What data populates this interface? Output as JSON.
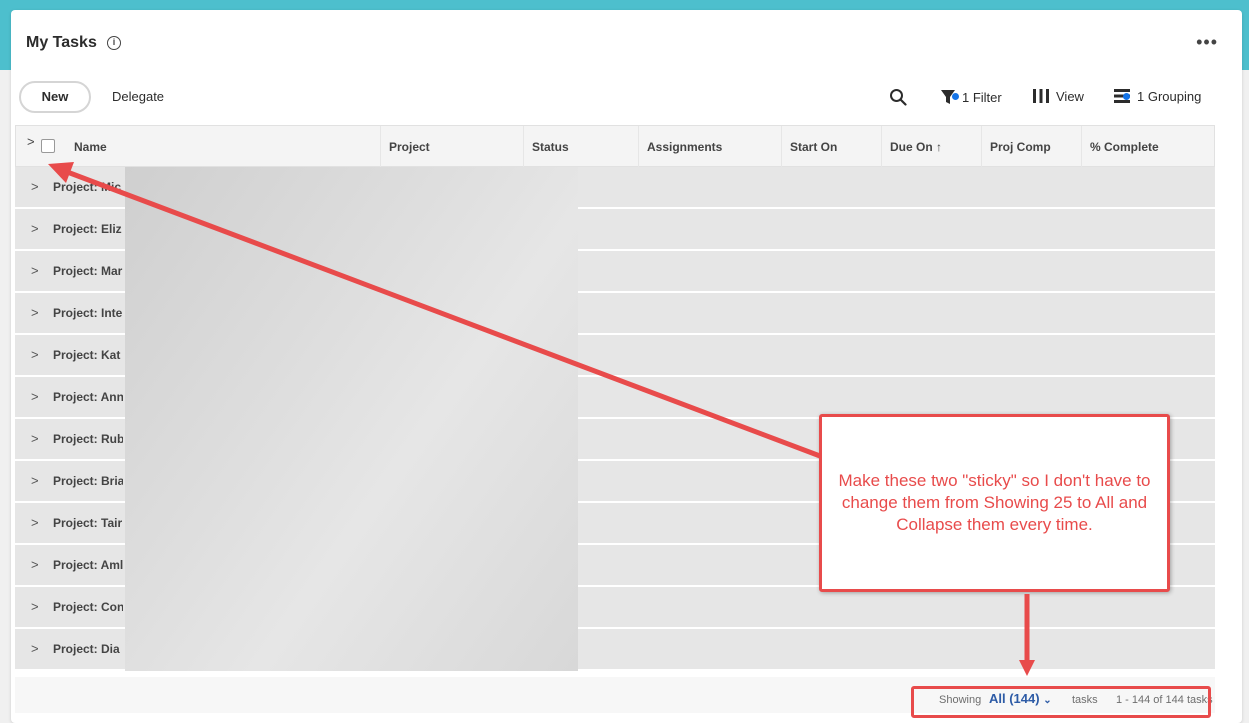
{
  "page": {
    "title": "My Tasks"
  },
  "toolbar": {
    "new_label": "New",
    "delegate_label": "Delegate",
    "filter_label": "1 Filter",
    "view_label": "View",
    "grouping_label": "1 Grouping"
  },
  "table": {
    "columns": [
      "Name",
      "Project",
      "Status",
      "Assignments",
      "Start On",
      "Due On ↑",
      "Proj Comp",
      "% Complete"
    ],
    "rows": [
      "Project: Mic",
      "Project: Eliz",
      "Project: Mar",
      "Project: Inte",
      "Project: Kat",
      "Project: Ann",
      "Project: Rub",
      "Project: Bria",
      "Project: Tair",
      "Project: Aml",
      "Project: Con",
      "Project: Dia"
    ]
  },
  "footer": {
    "showing_label": "Showing",
    "selected_value": "All (144)",
    "tasks_label": "tasks",
    "range_label": "1 - 144 of 144 tasks"
  },
  "annotation": {
    "callout_text": "Make these two \"sticky\" so I don't have to change them from Showing 25 to All and Collapse them every time."
  },
  "colors": {
    "accent": "#1473e6",
    "annotation_red": "#e84b4b",
    "header_teal": "#4dbfcd",
    "link_blue": "#2d5ba6"
  }
}
